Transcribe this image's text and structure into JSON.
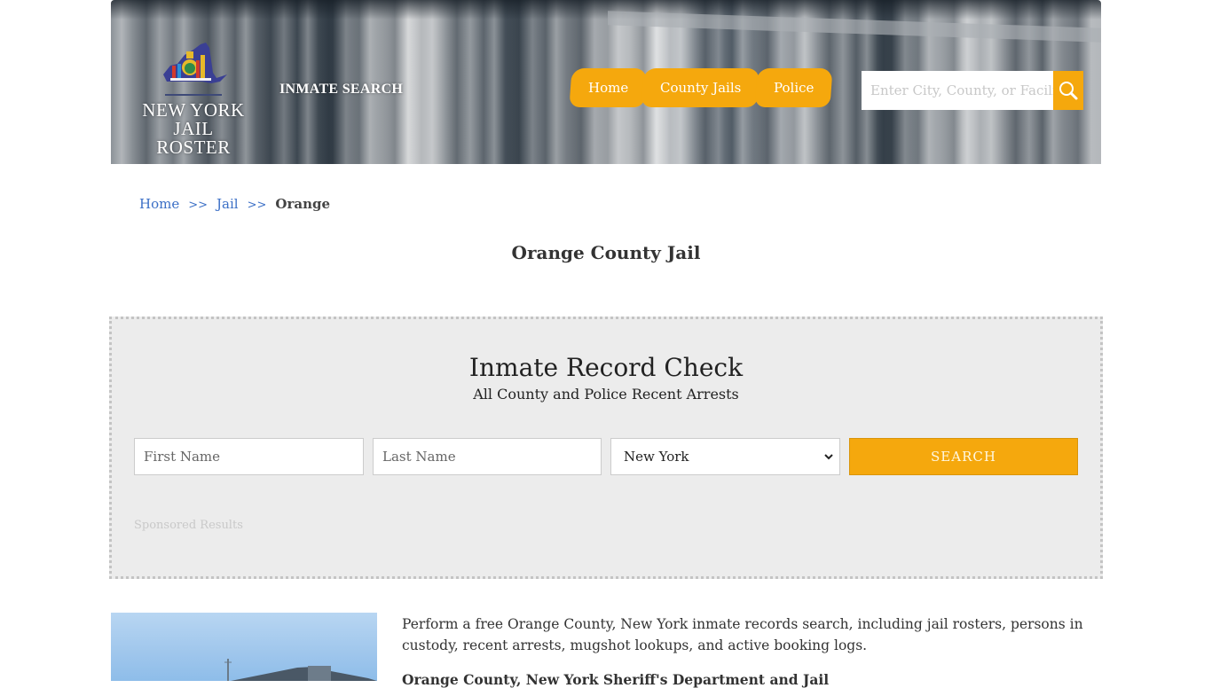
{
  "header": {
    "logo_line1": "NEW YORK",
    "logo_line2": "JAIL ROSTER",
    "inmate_search_link": "INMATE SEARCH",
    "nav": [
      {
        "label": "Home"
      },
      {
        "label": "County Jails"
      },
      {
        "label": "Police"
      }
    ],
    "search_placeholder": "Enter City, County, or Facility",
    "accent_color": "#f5a80d"
  },
  "breadcrumb": {
    "items": [
      {
        "label": "Home"
      },
      {
        "label": "Jail"
      }
    ],
    "separator": ">>",
    "current": "Orange"
  },
  "page_title": "Orange County Jail",
  "record_check": {
    "title": "Inmate Record Check",
    "subtitle": "All County and Police Recent Arrests",
    "first_name_placeholder": "First Name",
    "last_name_placeholder": "Last Name",
    "state_selected": "New York",
    "search_button": "SEARCH",
    "sponsored_label": "Sponsored Results"
  },
  "content": {
    "intro": "Perform a free Orange County, New York inmate records search, including jail rosters, persons in custody, recent arrests, mugshot lookups, and active booking logs.",
    "subheading": "Orange County, New York Sheriff's Department and Jail"
  }
}
